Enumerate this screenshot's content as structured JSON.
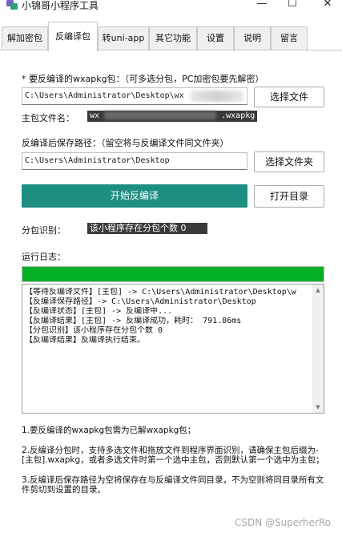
{
  "window": {
    "title": "小锦哥小程序工具",
    "minimize_glyph": "—",
    "maximize_glyph": "☐",
    "close_glyph": "✕"
  },
  "tabs": [
    {
      "label": "解加密包",
      "active": false
    },
    {
      "label": "反编译包",
      "active": true
    },
    {
      "label": "转uni-app",
      "active": false
    },
    {
      "label": "其它功能",
      "active": false
    },
    {
      "label": "设置",
      "active": false
    },
    {
      "label": "说明",
      "active": false
    },
    {
      "label": "留言",
      "active": false
    }
  ],
  "form": {
    "package_label": "* 要反编译的wxapkg包：（可多选分包，PC加密包要先解密）",
    "package_path_prefix": "C:\\Users\\Administrator\\Desktop\\wx",
    "select_file_button": "选择文件",
    "main_package_label": "主包文件名：",
    "main_package_prefix": "wx",
    "main_package_suffix": ".wxapkg",
    "output_label": "反编译后保存路径：（留空将与反编译文件同文件夹）",
    "output_path": "C:\\Users\\Administrator\\Desktop",
    "select_folder_button": "选择文件夹",
    "start_button": "开始反编译",
    "open_dir_button": "打开目录",
    "subpackage_label": "分包识别：",
    "subpackage_value": "该小程序存在分包个数 0",
    "log_label": "运行日志："
  },
  "progress": {
    "percent": 100,
    "color": "#06b025"
  },
  "log_lines": [
    "【等待反编译文件】[主包] -> C:\\Users\\Administrator\\Desktop\\w",
    "【反编译保存路径】-> C:\\Users\\Administrator\\Desktop",
    "【反编译状态】[主包] -> 反编译中...",
    "【反编译结果】[主包] -> 反编译成功，耗时： 791.86ms",
    "【分包识别】该小程序存在分包个数 0",
    "【反编译结果】反编译执行结束。"
  ],
  "notes": [
    "1.要反编译的wxapkg包需为已解wxapkg包；",
    "2.反编译分包时，支持多选文件和拖放文件到程序界面识别，请确保主包后缀为-[主包].wxapkg，或者多选文件时第一个选中主包，否则默认第一个选中为主包；",
    "3.反编译后保存路径为空将保存在与反编译文件同目录，不为空则将同目录所有文件剪切到设置的目录。"
  ],
  "watermark": "CSDN @SuperherRo",
  "colors": {
    "accent": "#1d8f82",
    "highlight_bg": "#3a3a3a"
  }
}
